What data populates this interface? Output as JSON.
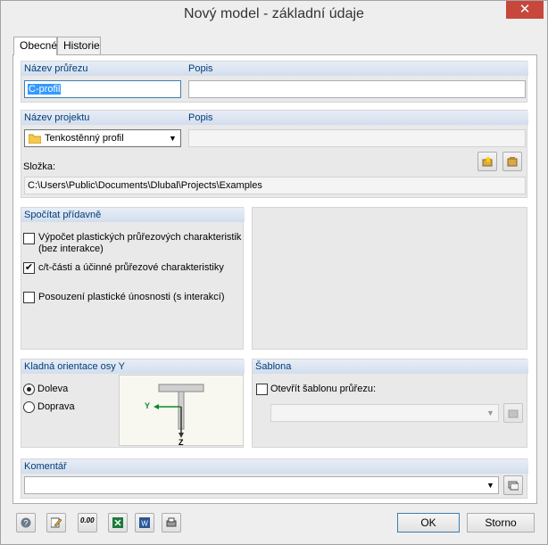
{
  "window": {
    "title": "Nový model - základní údaje",
    "close_glyph": "✕"
  },
  "tabs": [
    {
      "label": "Obecné",
      "active": true
    },
    {
      "label": "Historie",
      "active": false
    }
  ],
  "section_name": {
    "label": "Název průřezu",
    "value": "C-profil",
    "desc_label": "Popis",
    "desc_value": ""
  },
  "section_project": {
    "label": "Název projektu",
    "value": "Tenkostěnný profil",
    "desc_label": "Popis",
    "desc_value": "",
    "folder_label": "Složka:",
    "folder_value": "C:\\Users\\Public\\Documents\\Dlubal\\Projects\\Examples"
  },
  "calc": {
    "title": "Spočítat přídavně",
    "items": [
      {
        "label": "Výpočet plastických průřezových charakteristik",
        "label2": "(bez interakce)",
        "checked": false
      },
      {
        "label": "c/t-části a účinné průřezové charakteristiky",
        "checked": true
      },
      {
        "label": "Posouzení plastické únosnosti (s interakcí)",
        "checked": false
      }
    ]
  },
  "orientation": {
    "title": "Kladná orientace osy Y",
    "options": [
      {
        "label": "Doleva",
        "selected": true
      },
      {
        "label": "Doprava",
        "selected": false
      }
    ],
    "axis_y": "Y",
    "axis_z": "Z"
  },
  "template": {
    "title": "Šablona",
    "open_label": "Otevřít šablonu průřezu:",
    "checked": false,
    "value": ""
  },
  "comment": {
    "title": "Komentář",
    "value": ""
  },
  "footer": {
    "ok": "OK",
    "cancel": "Storno",
    "units_text": "0.00"
  },
  "colors": {
    "accent": "#003d78",
    "header": "#d2dded",
    "close": "#c7473d"
  }
}
